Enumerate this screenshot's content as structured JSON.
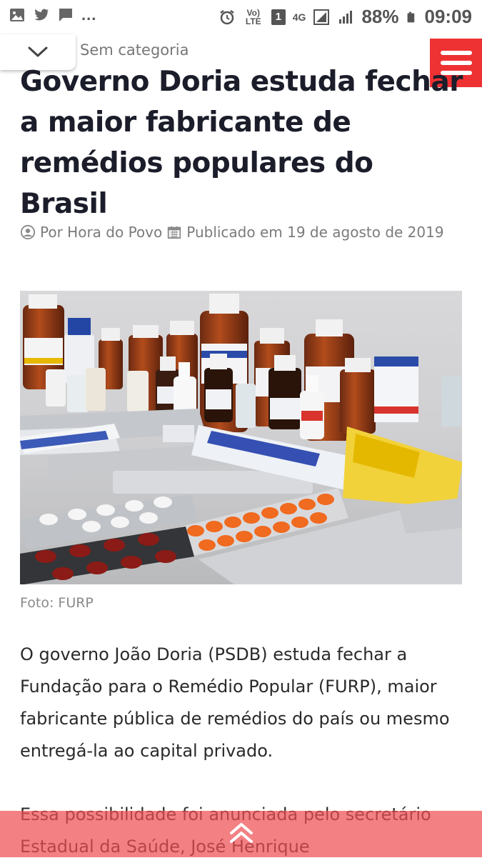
{
  "status_bar": {
    "dots": "...",
    "lte_label": "Vo) LTE",
    "sim": "1",
    "network": "4G",
    "battery": "88%",
    "time": "09:09"
  },
  "header": {
    "category": "Sem categoria",
    "menu_icon": "hamburger-icon",
    "collapse_icon": "chevron-down-icon",
    "accent_color": "#ee3133"
  },
  "article": {
    "title": "Governo Doria estuda fechar a maior fabricante de remédios populares do Brasil",
    "author": "Por Hora do Povo",
    "published": "Publicado em 19 de agosto de 2019",
    "photo_caption": "Foto: FURP",
    "paragraphs": [
      "O governo João Doria (PSDB) estuda fechar a Fundação para o Remédio Popular (FURP), maior fabricante pública de remédios do país ou mesmo entregá-la ao capital privado.",
      "Essa possibilidade foi anunciada pelo secretário Estadual da Saúde, José Henrique"
    ]
  }
}
